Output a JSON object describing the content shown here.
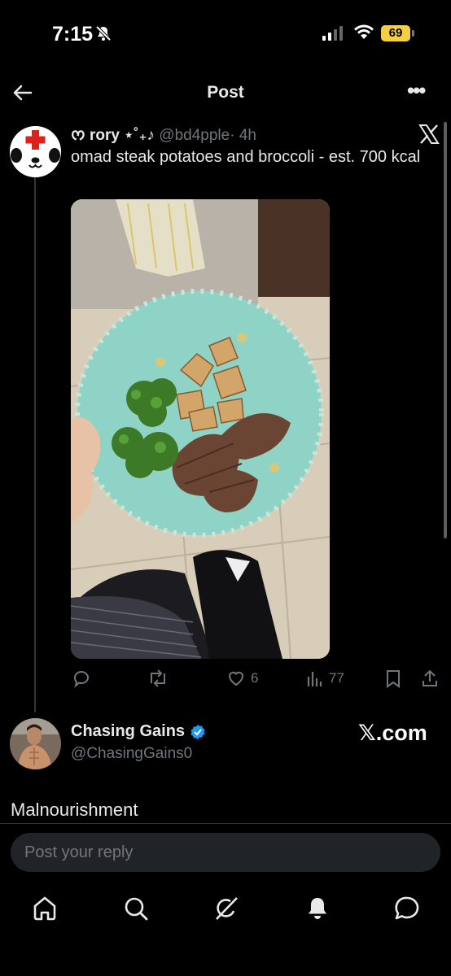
{
  "status_bar": {
    "time": "7:15",
    "battery": "69"
  },
  "header": {
    "title": "Post"
  },
  "quoted_post": {
    "author_name": "ᰔ rory ⋆˚₊♪",
    "handle": "@bd4pple",
    "time": "· 4h",
    "text": "omad steak potatoes and broccoli - est. 700 kcal",
    "likes": "6",
    "views": "77"
  },
  "reply": {
    "author_name": "Chasing Gains",
    "handle": "@ChasingGains0",
    "brand": "𝕏.com",
    "text": "Malnourishment"
  },
  "composer": {
    "placeholder": "Post your reply"
  },
  "icons": [
    "back-arrow-icon",
    "more-icon",
    "x-logo-icon",
    "reply-icon",
    "repost-icon",
    "like-icon",
    "views-icon",
    "bookmark-icon",
    "share-icon",
    "verified-icon",
    "home-icon",
    "search-icon",
    "grok-icon",
    "notifications-icon",
    "messages-icon"
  ]
}
